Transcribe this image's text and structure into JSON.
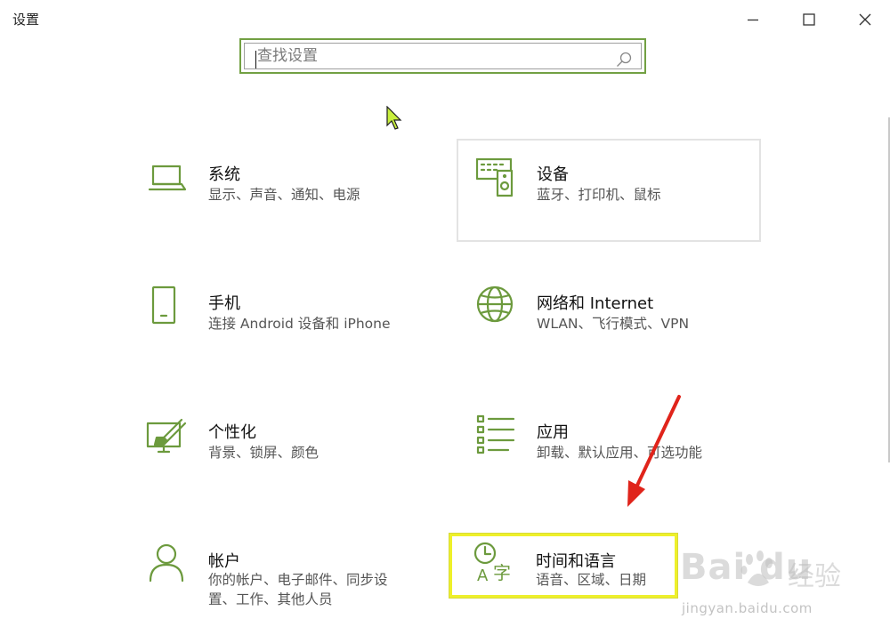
{
  "window": {
    "title": "设置",
    "minimize_label": "",
    "maximize_label": "",
    "close_label": ""
  },
  "search": {
    "placeholder": "查找设置",
    "value": ""
  },
  "categories": [
    {
      "title": "系统",
      "desc": [
        "显示、声音、通知、电源"
      ],
      "icon": "laptop-icon"
    },
    {
      "title": "设备",
      "desc": [
        "蓝牙、打印机、鼠标"
      ],
      "icon": "keyboard-speaker-icon"
    },
    {
      "title": "手机",
      "desc": [
        "连接 Android 设备和 iPhone"
      ],
      "icon": "phone-icon"
    },
    {
      "title": "网络和 Internet",
      "desc": [
        "WLAN、飞行模式、VPN"
      ],
      "icon": "globe-icon"
    },
    {
      "title": "个性化",
      "desc": [
        "背景、锁屏、颜色"
      ],
      "icon": "paint-screen-icon"
    },
    {
      "title": "应用",
      "desc": [
        "卸载、默认应用、可选功能"
      ],
      "icon": "app-list-icon"
    },
    {
      "title": "帐户",
      "desc": [
        "你的帐户、电子邮件、同步设",
        "置、工作、其他人员"
      ],
      "icon": "person-icon"
    },
    {
      "title": "时间和语言",
      "desc": [
        "语音、区域、日期"
      ],
      "icon": "clock-language-icon"
    }
  ],
  "watermark": {
    "logo": "Bai du",
    "cn": "经验",
    "url": "jingyan.baidu.com"
  },
  "colors": {
    "accent": "#6c9a3d",
    "highlight": "#eef02a",
    "arrow": "#e0241b"
  }
}
